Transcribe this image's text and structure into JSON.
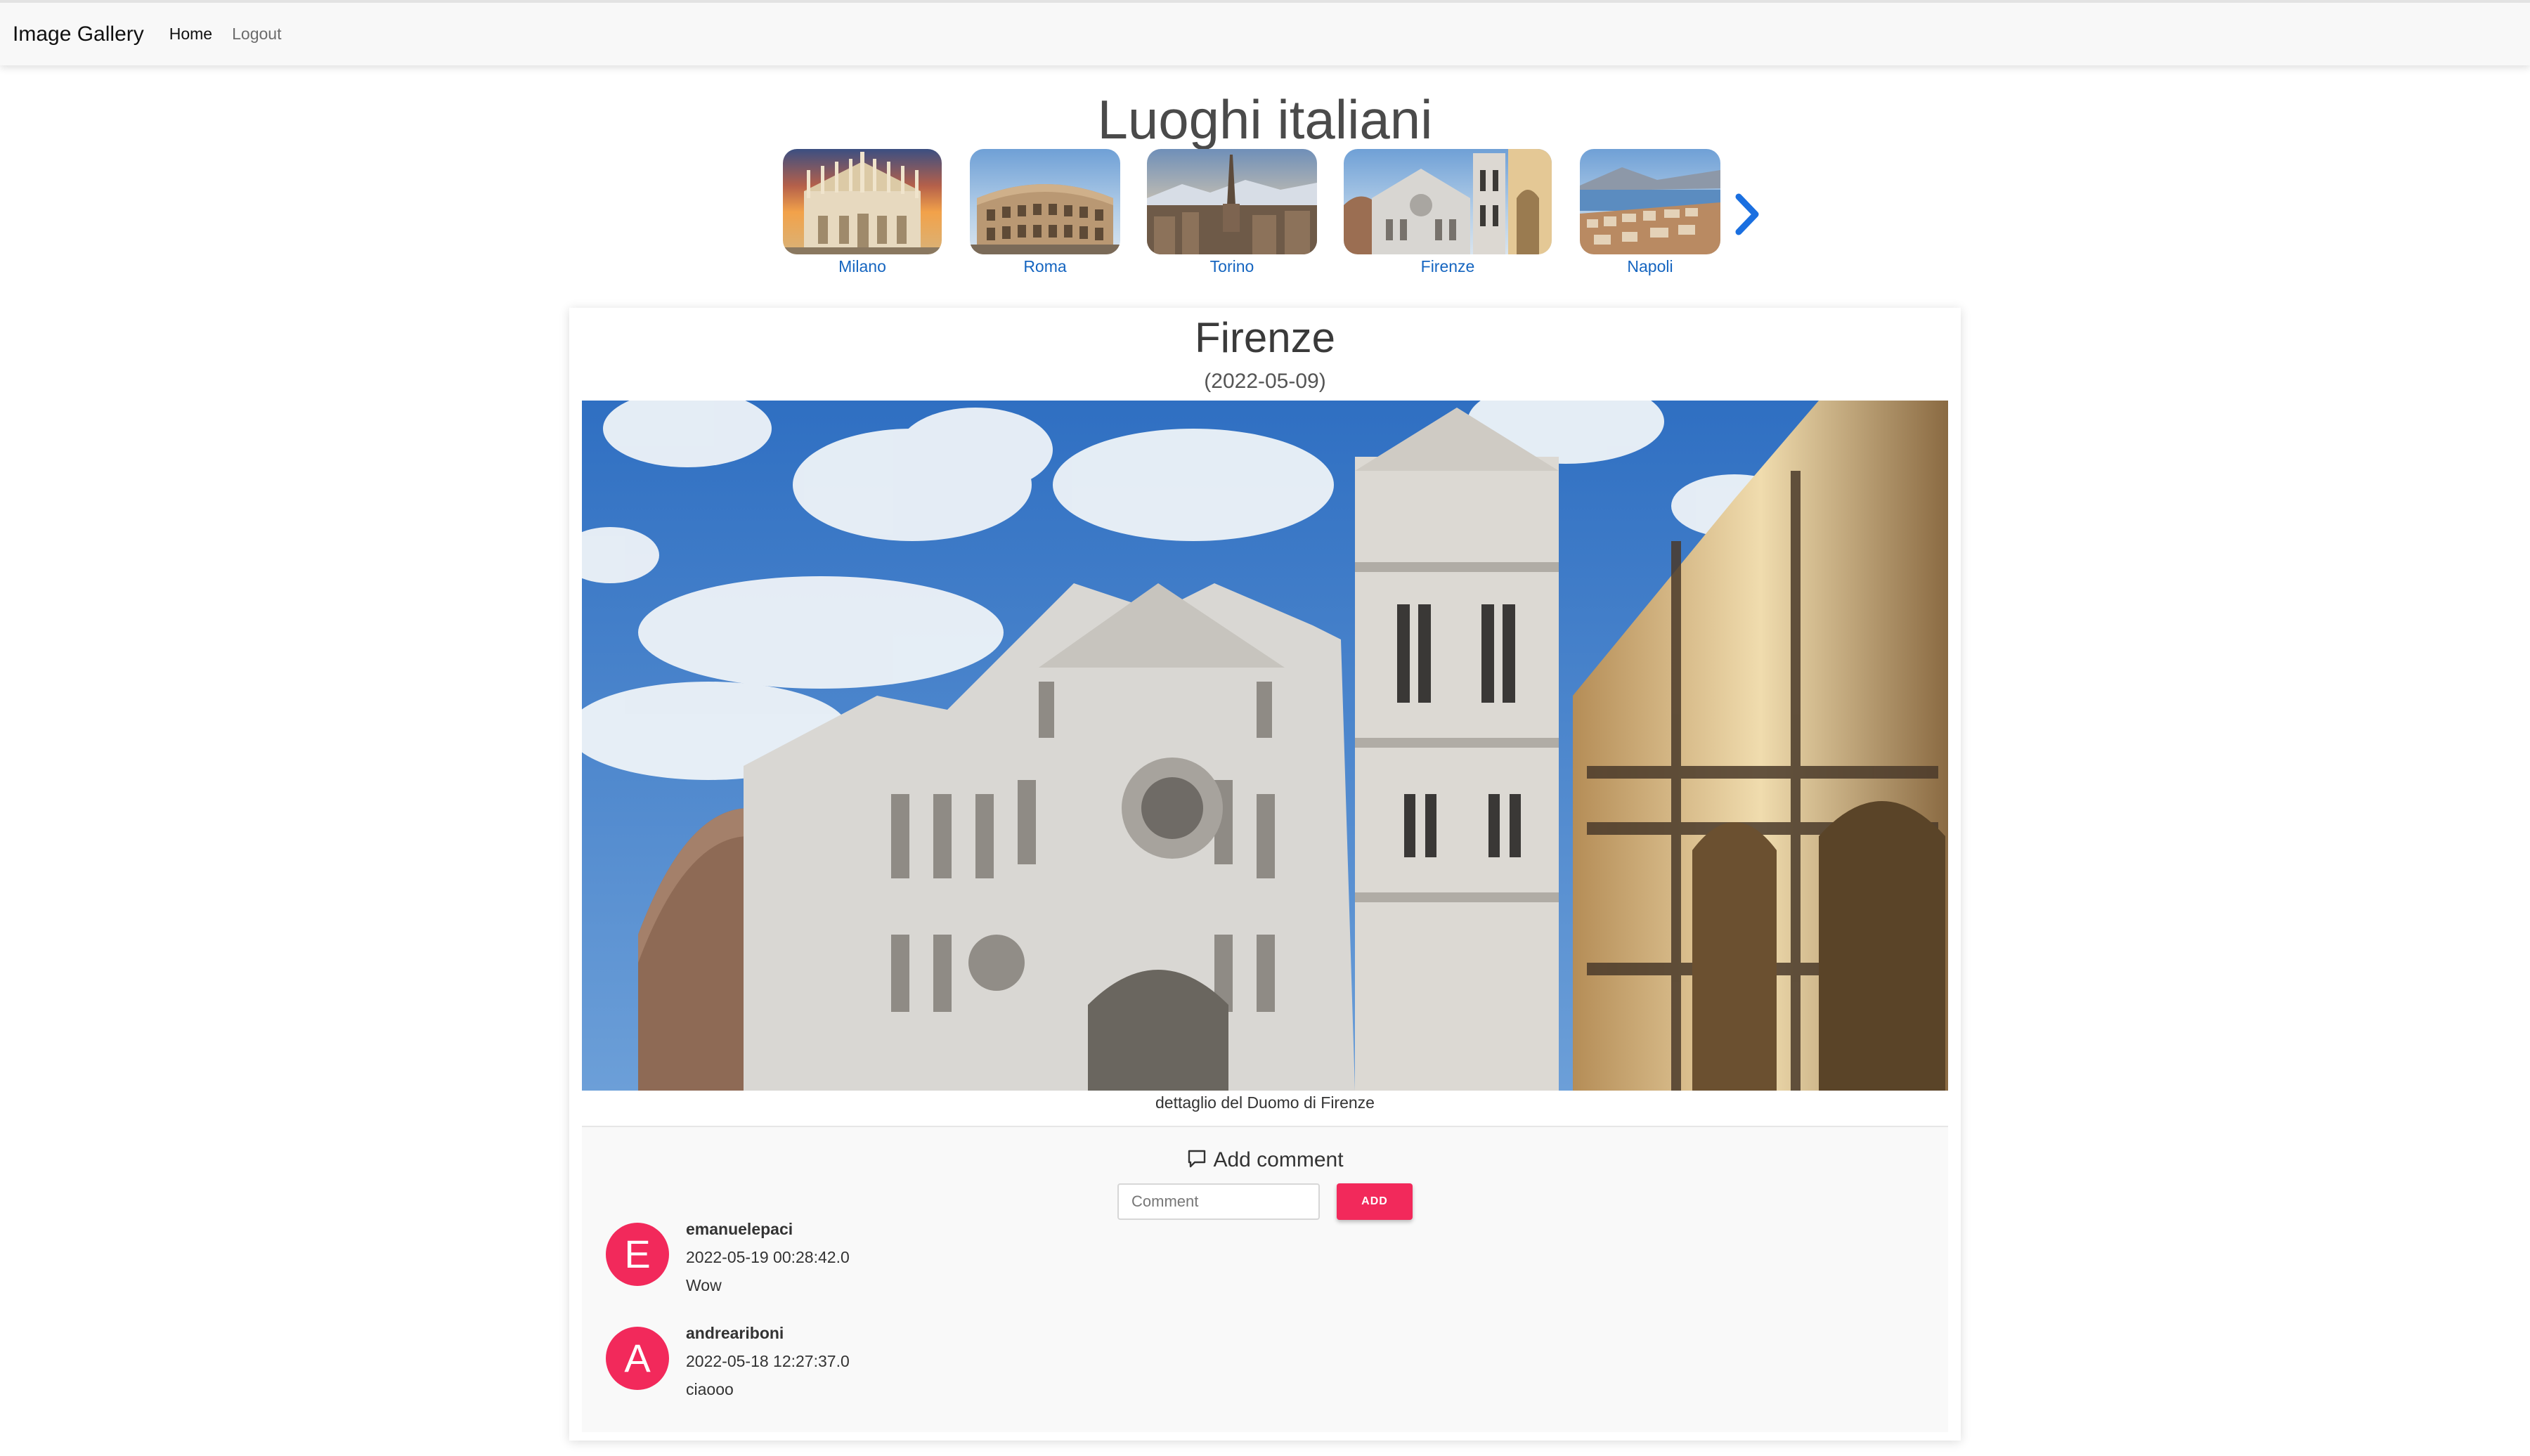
{
  "navbar": {
    "brand": "Image Gallery",
    "links": [
      {
        "label": "Home"
      },
      {
        "label": "Logout"
      }
    ]
  },
  "album": {
    "title": "Luoghi italiani",
    "thumbnails": [
      {
        "label": "Milano"
      },
      {
        "label": "Roma"
      },
      {
        "label": "Torino"
      },
      {
        "label": "Firenze"
      },
      {
        "label": "Napoli"
      }
    ],
    "next_icon": "chevron-right-icon"
  },
  "photo": {
    "title": "Firenze",
    "date": "(2022-05-09)",
    "caption": "dettaglio del Duomo di Firenze"
  },
  "comments": {
    "heading": "Add comment",
    "heading_icon": "comment-icon",
    "input_placeholder": "Comment",
    "input_value": "",
    "add_label": "ADD",
    "items": [
      {
        "initial": "E",
        "user": "emanuelepaci",
        "date": "2022-05-19 00:28:42.0",
        "text": "Wow"
      },
      {
        "initial": "A",
        "user": "andreariboni",
        "date": "2022-05-18 12:27:37.0",
        "text": "ciaooo"
      }
    ]
  },
  "colors": {
    "accent": "#f2295b",
    "link": "#1565c0",
    "chevron": "#1a6fe0"
  }
}
